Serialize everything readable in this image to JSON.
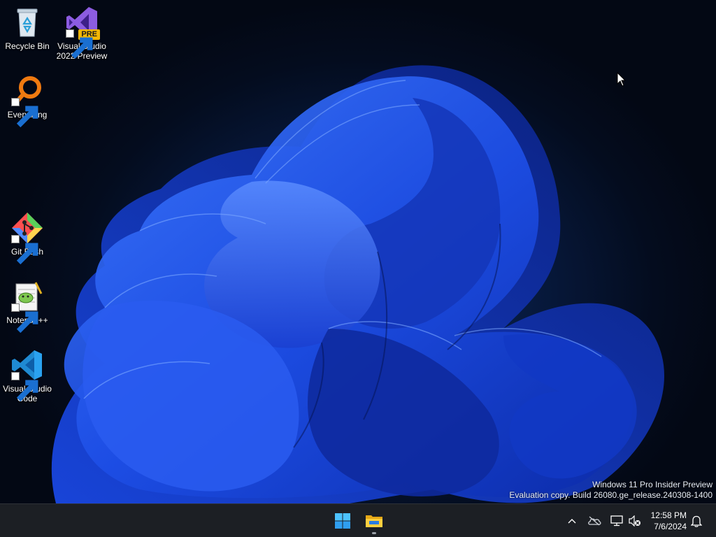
{
  "desktop": {
    "icons": [
      {
        "label": "Recycle Bin",
        "icon": "recycle-bin-icon"
      },
      {
        "label": "Visual Studio 2022 Preview",
        "badge": "PRE",
        "icon": "visual-studio-icon"
      },
      {
        "label": "Everything",
        "icon": "everything-search-icon"
      },
      {
        "label": "Git Bash",
        "icon": "git-bash-icon"
      },
      {
        "label": "Notepad++",
        "icon": "notepad-plus-plus-icon"
      },
      {
        "label": "Visual Studio Code",
        "icon": "vscode-icon"
      }
    ],
    "watermark": {
      "line1": "Windows 11 Pro Insider Preview",
      "line2": "Evaluation copy. Build 26080.ge_release.240308-1400"
    }
  },
  "taskbar": {
    "pinned": [
      {
        "icon": "windows-start-icon"
      },
      {
        "icon": "file-explorer-icon"
      }
    ],
    "tray": {
      "icons": [
        "chevron-up-icon",
        "onedrive-icon",
        "network-icon",
        "volume-muted-icon",
        "notification-bell-icon"
      ],
      "time": "12:58 PM",
      "date": "7/6/2024"
    }
  },
  "colors": {
    "accent": "#2d6cff",
    "taskbar": "#1c1f24",
    "windows_logo": "#4cc2ff"
  }
}
